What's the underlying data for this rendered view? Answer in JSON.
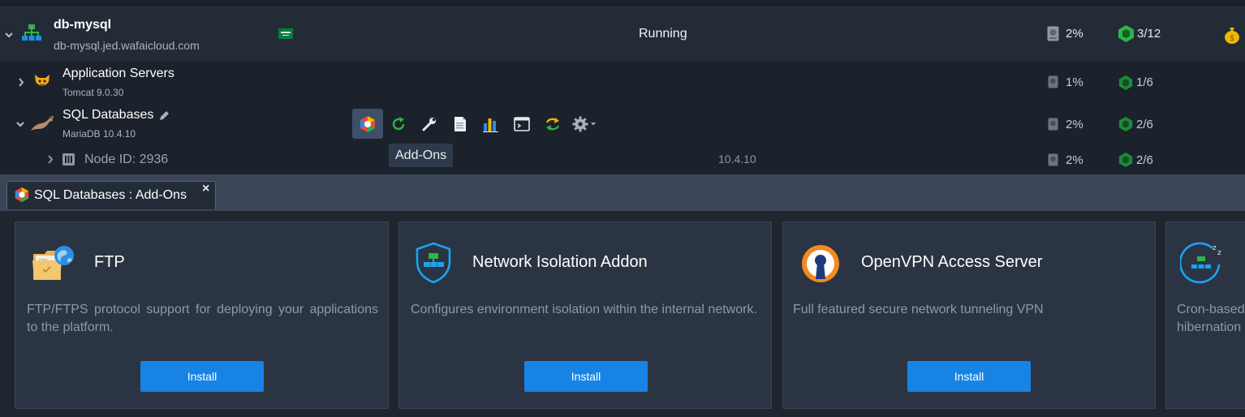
{
  "environment": {
    "name": "db-mysql",
    "domain": "db-mysql.jed.wafaicloud.com",
    "status": "Running",
    "disk": "2%",
    "cloudlets": "3/12"
  },
  "nodes": [
    {
      "title": "Application Servers",
      "subtitle": "Tomcat 9.0.30",
      "disk": "1%",
      "cloudlets": "1/6"
    },
    {
      "title": "SQL Databases",
      "subtitle": "MariaDB 10.4.10",
      "disk": "2%",
      "cloudlets": "2/6"
    }
  ],
  "node_instance": {
    "label": "Node ID: 2936",
    "version": "10.4.10",
    "disk": "2%",
    "cloudlets": "2/6"
  },
  "toolbar": {
    "tooltip": "Add-Ons",
    "icons": [
      "addons-icon",
      "restart-icon",
      "config-icon",
      "log-icon",
      "statistics-icon",
      "terminal-icon",
      "redeploy-icon",
      "settings-icon"
    ]
  },
  "tab": {
    "label": "SQL Databases : Add-Ons",
    "close": "×"
  },
  "addons": [
    {
      "title": "FTP",
      "description": "FTP/FTPS protocol support for deploying your applications to the platform.",
      "button": "Install"
    },
    {
      "title": "Network Isolation Addon",
      "description": "Configures environment isolation within the internal network.",
      "button": "Install"
    },
    {
      "title": "OpenVPN Access Server",
      "description": "Full featured secure network tunneling VPN",
      "button": "Install"
    },
    {
      "title": "",
      "description": "Cron-based hibernation",
      "button": ""
    }
  ],
  "colors": {
    "accent": "#1784e5",
    "running": "#2fb34a",
    "panel": "#2b3442"
  }
}
